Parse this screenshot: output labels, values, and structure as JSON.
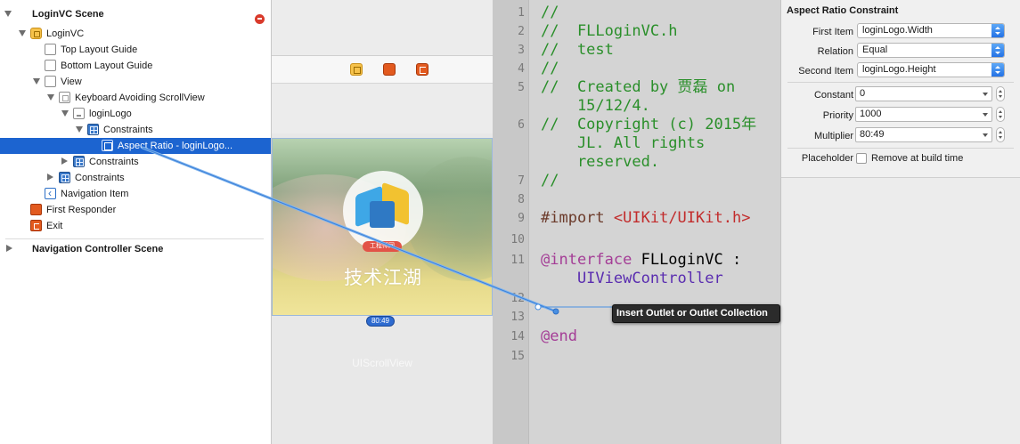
{
  "outline": {
    "items": [
      {
        "label": "LoginVC Scene",
        "kind": "scene"
      },
      {
        "label": "LoginVC",
        "kind": "vc"
      },
      {
        "label": "Top Layout Guide",
        "kind": "view"
      },
      {
        "label": "Bottom Layout Guide",
        "kind": "view"
      },
      {
        "label": "View",
        "kind": "view"
      },
      {
        "label": "Keyboard Avoiding ScrollView",
        "kind": "scroll"
      },
      {
        "label": "loginLogo",
        "kind": "img"
      },
      {
        "label": "Constraints",
        "kind": "cons"
      },
      {
        "label": "Aspect Ratio - loginLogo...",
        "kind": "aspect",
        "selected": true
      },
      {
        "label": "Constraints",
        "kind": "cons"
      },
      {
        "label": "Constraints",
        "kind": "cons"
      },
      {
        "label": "Navigation Item",
        "kind": "nav"
      },
      {
        "label": "First Responder",
        "kind": "first"
      },
      {
        "label": "Exit",
        "kind": "exit"
      },
      {
        "label": "Navigation Controller Scene",
        "kind": "scene"
      }
    ]
  },
  "canvas": {
    "logo_tag": "工程师网",
    "logo_text": "技术江湖",
    "ratio_pill": "80:49",
    "scrollview_label": "UIScrollView"
  },
  "editor": {
    "line_numbers": [
      "1",
      "2",
      "3",
      "4",
      "5",
      "",
      "6",
      "",
      "",
      "7",
      "8",
      "9",
      "10",
      "11",
      "",
      "12",
      "13",
      "14",
      "15"
    ],
    "lines": [
      {
        "text": "//",
        "style": "cmt"
      },
      {
        "text": "//  FLLoginVC.h",
        "style": "cmt"
      },
      {
        "text": "//  test",
        "style": "cmt"
      },
      {
        "text": "//",
        "style": "cmt"
      },
      {
        "text": "//  Created by 贾磊 on",
        "style": "cmt"
      },
      {
        "text": "    15/12/4.",
        "style": "cmt"
      },
      {
        "text": "//  Copyright (c) 2015年",
        "style": "cmt"
      },
      {
        "text": "    JL. All rights",
        "style": "cmt"
      },
      {
        "text": "    reserved.",
        "style": "cmt"
      },
      {
        "text": "//",
        "style": "cmt"
      },
      {
        "text": "",
        "style": ""
      },
      {
        "text": "#import <UIKit/UIKit.h>",
        "style": "import"
      },
      {
        "text": "",
        "style": ""
      },
      {
        "text": "@interface FLLoginVC :",
        "style": "iface"
      },
      {
        "text": "    UIViewController",
        "style": "cls"
      },
      {
        "text": "",
        "style": ""
      },
      {
        "text": "",
        "style": ""
      },
      {
        "text": "@end",
        "style": "kw"
      },
      {
        "text": "",
        "style": ""
      }
    ],
    "import_kw": "#import",
    "import_path": "<UIKit/UIKit.h>",
    "iface_kw": "@interface",
    "iface_rest": " FLLoginVC :",
    "tooltip": "Insert Outlet or Outlet Collection"
  },
  "inspector": {
    "title": "Aspect Ratio Constraint",
    "first_item_label": "First Item",
    "first_item_value": "loginLogo.Width",
    "relation_label": "Relation",
    "relation_value": "Equal",
    "second_item_label": "Second Item",
    "second_item_value": "loginLogo.Height",
    "constant_label": "Constant",
    "constant_value": "0",
    "priority_label": "Priority",
    "priority_value": "1000",
    "multiplier_label": "Multiplier",
    "multiplier_value": "80:49",
    "placeholder_label": "Placeholder",
    "placeholder_option": "Remove at build time"
  },
  "colors": {
    "selection": "#1c64d0",
    "comment": "#2a8f2a",
    "keyword": "#a43d96",
    "connection_line": "#4a90e2"
  }
}
